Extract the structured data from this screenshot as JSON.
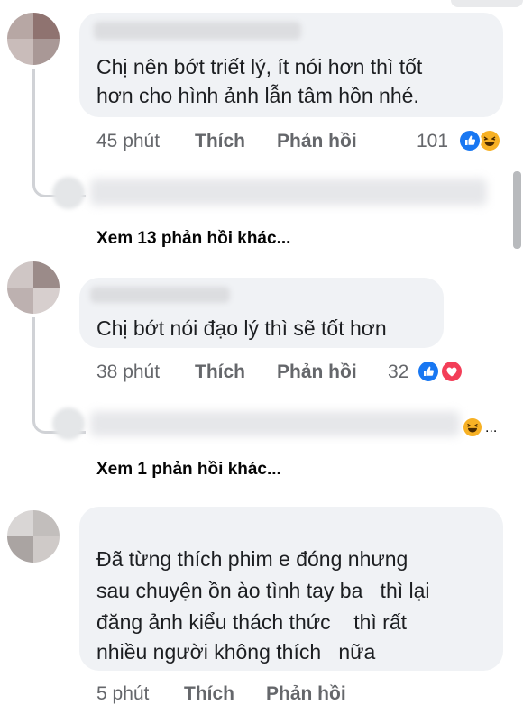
{
  "comments": [
    {
      "text_lines": [
        "Chị nên bớt triết lý, ít nói hơn thì tốt",
        "hơn cho hình ảnh lẫn tâm hồn nhé."
      ],
      "time": "45 phút",
      "like_label": "Thích",
      "reply_label": "Phản hồi",
      "reaction_count": "101",
      "reactions": [
        "like-icon",
        "haha-icon"
      ],
      "more_replies": "Xem 13 phản hồi khác..."
    },
    {
      "text_lines": [
        "Chị bớt nói đạo lý thì sẽ tốt hơn"
      ],
      "time": "38 phút",
      "like_label": "Thích",
      "reply_label": "Phản hồi",
      "reaction_count": "32",
      "reactions": [
        "like-icon",
        "love-icon"
      ],
      "more_replies": "Xem 1 phản hồi khác..."
    },
    {
      "text_lines": [
        "Đã từng thích phim e đóng nhưng",
        "sau chuyện ồn ào tình tay ba   thì lại",
        "đăng ảnh kiểu thách thức    thì rất",
        "nhiều người không thích   nữa"
      ],
      "time": "5 phút",
      "like_label": "Thích",
      "reply_label": "Phản hồi"
    }
  ],
  "reply_preview_suffix": "...",
  "colors": {
    "bubble": "#f0f2f5",
    "meta": "#65676b",
    "like": "#1877f2",
    "love": "#f33e58",
    "haha": "#f7b125"
  }
}
